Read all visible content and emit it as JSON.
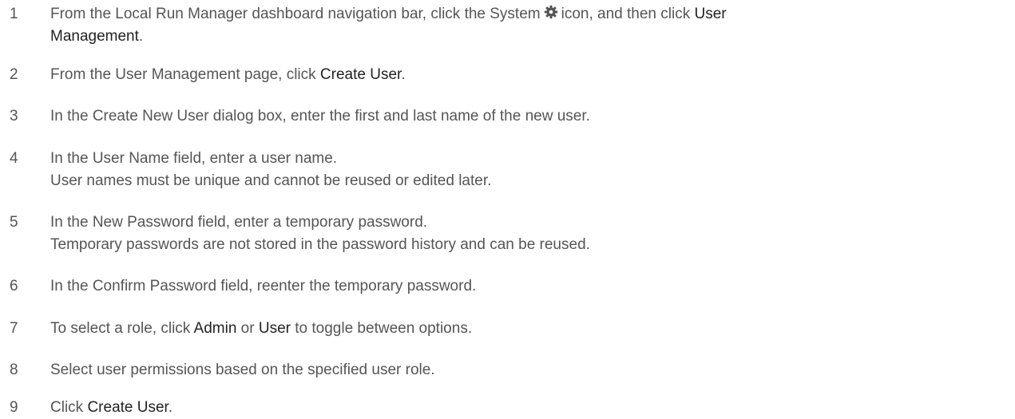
{
  "steps": [
    {
      "number": "1",
      "segments": [
        "From the Local Run Manager dashboard navigation bar, click the System",
        "icon, and then click",
        "User",
        "Management",
        "."
      ]
    },
    {
      "number": "2",
      "segments": [
        "From the User Management page, click",
        "Create User",
        "."
      ]
    },
    {
      "number": "3",
      "segments": [
        "In the Create New User dialog box, enter the first and last name of the new user."
      ]
    },
    {
      "number": "4",
      "segments": [
        "In the User Name field, enter a user name.",
        "User names must be unique and cannot be reused or edited later."
      ]
    },
    {
      "number": "5",
      "segments": [
        "In the New Password field, enter a temporary password.",
        "Temporary passwords are not stored in the password history and can be reused."
      ]
    },
    {
      "number": "6",
      "segments": [
        "In the Confirm Password field, reenter the temporary password."
      ]
    },
    {
      "number": "7",
      "segments": [
        "To select a role, click",
        "Admin",
        "or",
        "User",
        "to toggle between options."
      ]
    },
    {
      "number": "8",
      "segments": [
        "Select user permissions based on the specified user role."
      ]
    },
    {
      "number": "9",
      "segments": [
        "Click",
        "Create User",
        "."
      ]
    }
  ],
  "icons": {
    "system": "gear-icon"
  },
  "colors": {
    "text": "#555555",
    "ui_term": "#222222",
    "icon": "#555555"
  }
}
